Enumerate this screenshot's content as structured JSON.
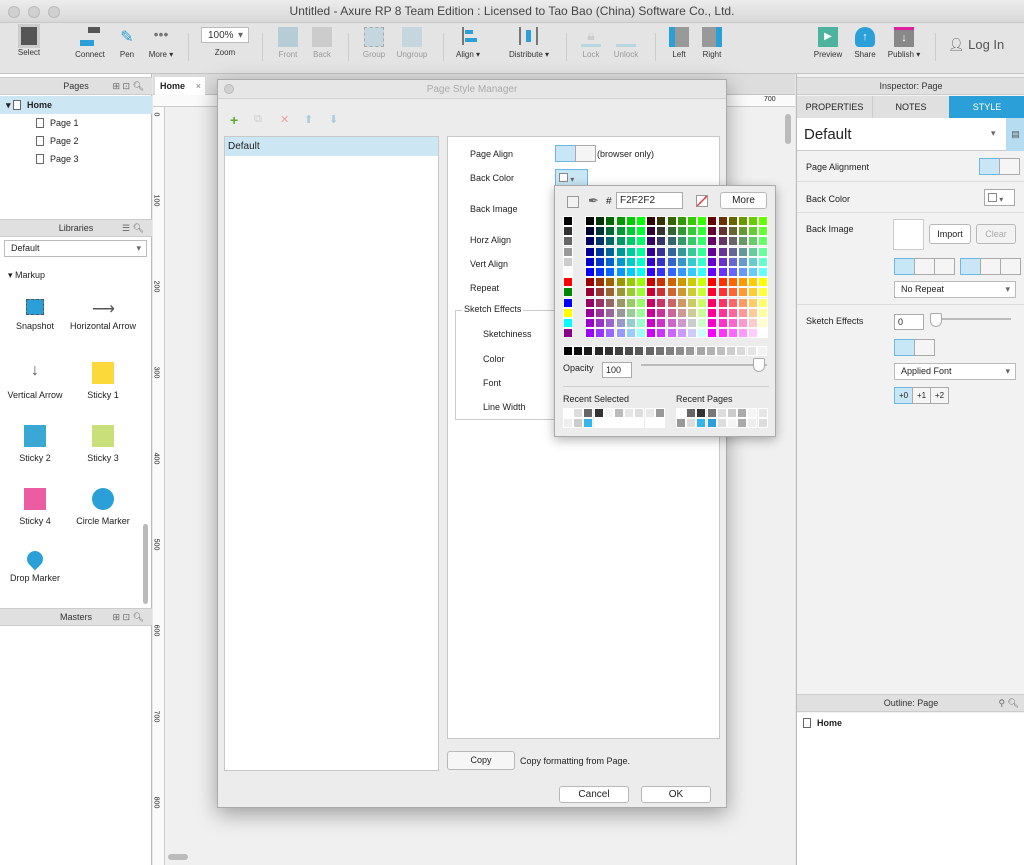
{
  "window": {
    "title": "Untitled - Axure RP 8 Team Edition : Licensed to Tao Bao (China) Software Co., Ltd."
  },
  "toolbar": {
    "select": "Select",
    "connect": "Connect",
    "pen": "Pen",
    "more": "More ▾",
    "zoom_value": "100%",
    "zoom": "Zoom",
    "front": "Front",
    "back": "Back",
    "group": "Group",
    "ungroup": "Ungroup",
    "align": "Align ▾",
    "distribute": "Distribute ▾",
    "lock": "Lock",
    "unlock": "Unlock",
    "left": "Left",
    "right": "Right",
    "preview": "Preview",
    "share": "Share",
    "publish": "Publish ▾",
    "login": "Log In"
  },
  "pages": {
    "title": "Pages",
    "items": [
      "Home",
      "Page 1",
      "Page 2",
      "Page 3"
    ]
  },
  "libraries": {
    "title": "Libraries",
    "selected": "Default",
    "group": "Markup",
    "widgets": [
      "Snapshot",
      "Horizontal Arrow",
      "Vertical Arrow",
      "Sticky 1",
      "Sticky 2",
      "Sticky 3",
      "Sticky 4",
      "Circle Marker",
      "Drop Marker"
    ]
  },
  "masters": {
    "title": "Masters"
  },
  "canvas": {
    "tab": "Home",
    "ruler_h": [
      "700"
    ],
    "ruler_v": [
      "0",
      "100",
      "200",
      "300",
      "400",
      "500",
      "600",
      "700",
      "800"
    ]
  },
  "dialog": {
    "title": "Page Style Manager",
    "styles": [
      "Default"
    ],
    "labels": {
      "page_align": "Page Align",
      "browser_only": "(browser only)",
      "back_color": "Back Color",
      "back_image": "Back Image",
      "horz_align": "Horz Align",
      "vert_align": "Vert Align",
      "repeat": "Repeat",
      "sketch_effects": "Sketch Effects",
      "sketchiness": "Sketchiness",
      "color": "Color",
      "font": "Font",
      "line_width": "Line Width"
    },
    "copy": "Copy",
    "copy_text": "Copy formatting from Page.",
    "cancel": "Cancel",
    "ok": "OK"
  },
  "color_picker": {
    "hash": "#",
    "hex": "F2F2F2",
    "more": "More",
    "opacity_label": "Opacity",
    "opacity": "100",
    "recent_selected": "Recent Selected",
    "recent_pages": "Recent Pages"
  },
  "inspector": {
    "title": "Inspector: Page",
    "tabs": [
      "PROPERTIES",
      "NOTES",
      "STYLE"
    ],
    "active_tab": "STYLE",
    "style": "Default",
    "page_alignment": "Page Alignment",
    "back_color": "Back Color",
    "back_image": "Back Image",
    "import": "Import",
    "clear": "Clear",
    "repeat": "No Repeat",
    "sketch_effects": "Sketch Effects",
    "sketch_value": "0",
    "font": "Applied Font",
    "line_widths": [
      "+0",
      "+1",
      "+2"
    ]
  },
  "outline": {
    "title": "Outline: Page",
    "item": "Home"
  },
  "colors": {
    "accent": "#2a9fd8",
    "selected_row": "#cde6f4"
  }
}
